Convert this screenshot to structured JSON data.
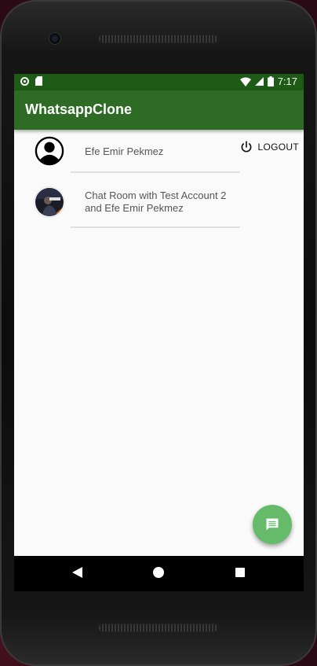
{
  "app": {
    "title": "WhatsappClone",
    "status_time": "7:17"
  },
  "toolbar": {
    "logout_label": "LOGOUT"
  },
  "chats": [
    {
      "name": "Efe Emir Pekmez",
      "avatar": "default-user-icon"
    },
    {
      "name": "Chat Room with Test Account 2 and Efe Emir Pekmez",
      "avatar": "photo-avatar"
    }
  ],
  "colors": {
    "status_bar": "#1e5b16",
    "app_bar": "#2e6b24",
    "fab": "#66bb6a"
  },
  "icons": {
    "logout": "power-icon",
    "fab": "chat-message-icon"
  }
}
